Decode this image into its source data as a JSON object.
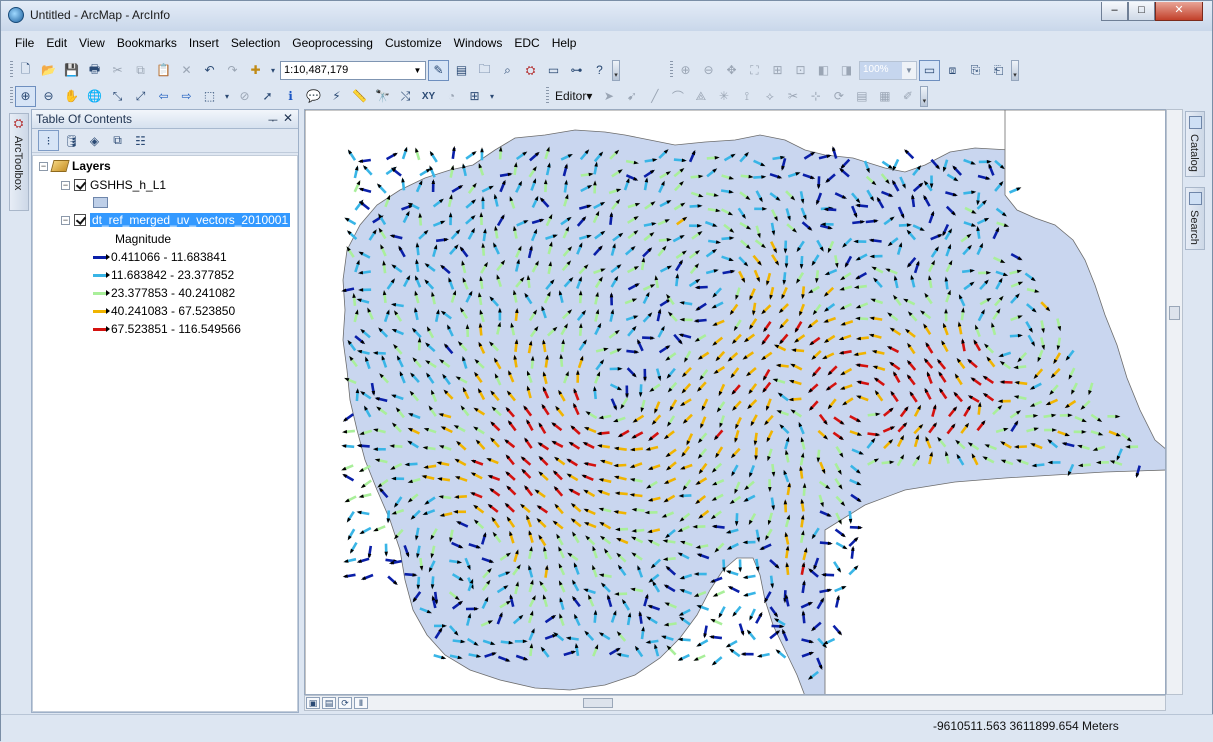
{
  "window": {
    "title": "Untitled - ArcMap - ArcInfo",
    "controls": {
      "minimize": "–",
      "maximize": "□",
      "close": "✕"
    }
  },
  "menu": [
    "File",
    "Edit",
    "View",
    "Bookmarks",
    "Insert",
    "Selection",
    "Geoprocessing",
    "Customize",
    "Windows",
    "EDC",
    "Help"
  ],
  "toolbar": {
    "scale": "1:10,487,179",
    "zoom_percent": "100%",
    "editor_label": "Editor▾"
  },
  "left_rail": {
    "label": "ArcToolbox"
  },
  "toc": {
    "title": "Table Of Contents",
    "pin": "ᅮ",
    "close": "✕",
    "root": {
      "expander": "−",
      "label": "Layers"
    },
    "layers": [
      {
        "expander": "−",
        "label": "GSHHS_h_L1",
        "checked": true,
        "selected": false
      },
      {
        "expander": "−",
        "label": "dt_ref_merged_uv_vectors_2010001",
        "checked": true,
        "selected": true
      }
    ],
    "legend_field": "Magnitude",
    "legend": [
      {
        "label": "0.411066 - 11.683841",
        "color": "#0a1fa8"
      },
      {
        "label": "11.683842 - 23.377852",
        "color": "#39b5e6"
      },
      {
        "label": "23.377853 - 40.241082",
        "color": "#a9ef9a"
      },
      {
        "label": "40.241083 - 67.523850",
        "color": "#f0b400"
      },
      {
        "label": "67.523851 - 116.549566",
        "color": "#d4120f"
      }
    ]
  },
  "right_rail": {
    "tabs": [
      "Catalog",
      "Search"
    ]
  },
  "map": {
    "water_color": "#c9d6ef",
    "land_color": "#ffffff"
  },
  "status": {
    "coordinates": "-9610511.563  3611899.654 Meters"
  }
}
